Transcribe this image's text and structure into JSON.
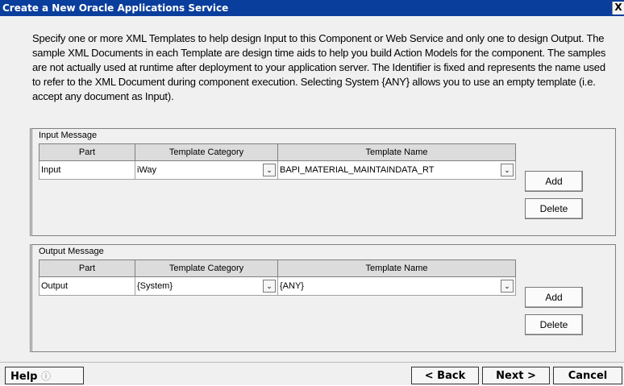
{
  "window": {
    "title": "Create a New Oracle Applications Service",
    "close_label": "X"
  },
  "description": "Specify one or more XML Templates to help design Input to this Component or Web Service and only one to design Output.  The sample XML Documents in each Template are design time aids to help you build Action Models for the component.  The samples are not actually used at runtime after deployment to your application server.  The Identifier is fixed and represents the name used to refer to the XML Document during component execution.  Selecting System {ANY} allows you to use an empty template (i.e. accept any document as Input).",
  "input_message": {
    "title": "Input Message",
    "columns": [
      "Part",
      "Template Category",
      "Template Name"
    ],
    "row": {
      "part": "Input",
      "category": "iWay",
      "template": "BAPI_MATERIAL_MAINTAINDATA_RT"
    },
    "add_label": "Add",
    "delete_label": "Delete"
  },
  "output_message": {
    "title": "Output Message",
    "columns": [
      "Part",
      "Template Category",
      "Template Name"
    ],
    "row": {
      "part": "Output",
      "category": "{System}",
      "template": "{ANY}"
    },
    "add_label": "Add",
    "delete_label": "Delete"
  },
  "footer": {
    "help_label": "Help",
    "back_label": "< Back",
    "next_label": "Next >",
    "cancel_label": "Cancel"
  }
}
